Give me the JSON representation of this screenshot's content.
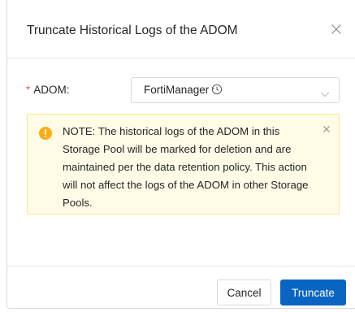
{
  "dialog": {
    "title": "Truncate Historical Logs of the ADOM",
    "close_icon": "close-icon"
  },
  "form": {
    "adom_label": "ADOM:",
    "required_marker": "*",
    "adom_select": {
      "value": "FortiManager",
      "value_icon": "clock-icon",
      "arrow_icon": "chevron-down-icon"
    }
  },
  "alert": {
    "icon": "warning-icon",
    "text": "NOTE: The historical logs of the ADOM in this Storage Pool will be marked for deletion and are maintained per the data retention policy. This action will not affect the logs of the ADOM in other Storage Pools.",
    "close_icon": "close-icon"
  },
  "footer": {
    "cancel_label": "Cancel",
    "truncate_label": "Truncate"
  },
  "colors": {
    "primary": "#0a65c2",
    "required": "#ff4d4f",
    "alert_bg": "#fffbe6",
    "alert_border": "#ffe58f",
    "alert_icon": "#faad14"
  }
}
